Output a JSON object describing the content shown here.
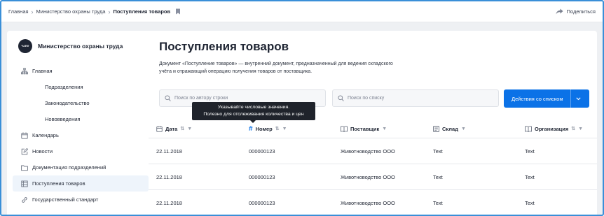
{
  "breadcrumbs": {
    "home": "Главная",
    "ministry": "Министерство охраны труда",
    "current": "Поступления товаров"
  },
  "share_label": "Поделиться",
  "org": {
    "logo_text": "ЧАЕФ",
    "name": "Министерство охраны труда"
  },
  "sidebar": {
    "items": [
      {
        "label": "Главная",
        "icon": "sitemap-icon"
      },
      {
        "label": "Подразделения"
      },
      {
        "label": "Законодательство"
      },
      {
        "label": "Нововведения"
      },
      {
        "label": "Календарь",
        "icon": "calendar-icon"
      },
      {
        "label": "Новости",
        "icon": "edit-icon"
      },
      {
        "label": "Документация подразделений",
        "icon": "folder-icon"
      },
      {
        "label": "Поступления товаров",
        "icon": "table-icon",
        "active": true
      },
      {
        "label": "Государственный стандарт",
        "icon": "link-icon"
      }
    ]
  },
  "main": {
    "title": "Поступления товаров",
    "description": "Документ «Поступление товаров» — внутренний документ, предназначенный для ведения складского учёта и отражающий операцию получения товаров от поставщика.",
    "search_author_placeholder": "Поиск по автору строки",
    "search_list_placeholder": "Поиск по списку",
    "action_button": "Действия со списком"
  },
  "tooltip": {
    "line1": "Указывайте числовые значения.",
    "line2": "Полезно для отслеживания количества и цен"
  },
  "table": {
    "columns": [
      "Дата",
      "Номер",
      "Поставщик",
      "Склад",
      "Организация"
    ],
    "rows": [
      [
        "22.11.2018",
        "000000123",
        "Животноводство ООО",
        "Text",
        "Text"
      ],
      [
        "22.11.2018",
        "000000123",
        "Животноводство ООО",
        "Text",
        "Text"
      ],
      [
        "22.11.2018",
        "000000123",
        "Животноводство ООО",
        "Text",
        "Text"
      ]
    ]
  },
  "colors": {
    "accent": "#0b72e7",
    "frame": "#3a8fd8",
    "active_bg": "#eef4fb"
  }
}
